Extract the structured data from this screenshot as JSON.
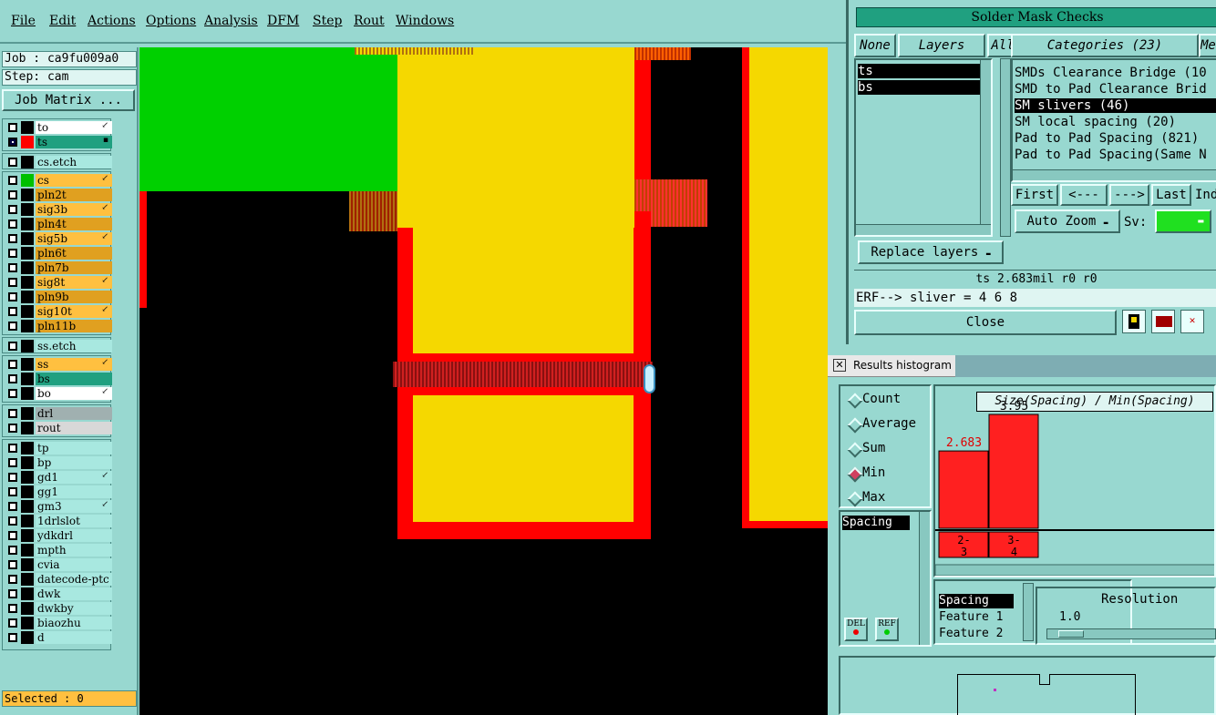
{
  "menu": {
    "items": [
      "File",
      "Edit",
      "Actions",
      "Options",
      "Analysis",
      "DFM",
      "Step",
      "Rout",
      "Windows"
    ]
  },
  "job": {
    "job_label": "Job : ca9fu009a0",
    "step_label": "Step: cam",
    "matrix_button": "Job Matrix ..."
  },
  "layers": {
    "group1": [
      {
        "name": "to",
        "color": "#000000",
        "bg": "#ffffff",
        "mark": "↙"
      },
      {
        "name": "ts",
        "color": "#ff0000",
        "bg": "#20a080",
        "mark": "▪",
        "selected": true
      }
    ],
    "group2": [
      {
        "name": "cs.etch",
        "color": "#000000",
        "bg": "#a8e8e0",
        "mark": ""
      }
    ],
    "group3": [
      {
        "name": "cs",
        "color": "#00c000",
        "bg": "#ffc040",
        "mark": "↙"
      },
      {
        "name": "pln2t",
        "color": "#000000",
        "bg": "#e0a020",
        "mark": ""
      },
      {
        "name": "sig3b",
        "color": "#000000",
        "bg": "#ffc040",
        "mark": "↙"
      },
      {
        "name": "pln4t",
        "color": "#000000",
        "bg": "#e0a020",
        "mark": ""
      },
      {
        "name": "sig5b",
        "color": "#000000",
        "bg": "#ffc040",
        "mark": "↙"
      },
      {
        "name": "pln6t",
        "color": "#000000",
        "bg": "#e0a020",
        "mark": ""
      },
      {
        "name": "pln7b",
        "color": "#000000",
        "bg": "#e0a020",
        "mark": ""
      },
      {
        "name": "sig8t",
        "color": "#000000",
        "bg": "#ffc040",
        "mark": "↙"
      },
      {
        "name": "pln9b",
        "color": "#000000",
        "bg": "#e0a020",
        "mark": ""
      },
      {
        "name": "sig10t",
        "color": "#000000",
        "bg": "#ffc040",
        "mark": "↙"
      },
      {
        "name": "pln11b",
        "color": "#000000",
        "bg": "#e0a020",
        "mark": ""
      }
    ],
    "group4": [
      {
        "name": "ss.etch",
        "color": "#000000",
        "bg": "#a8e8e0",
        "mark": ""
      }
    ],
    "group5": [
      {
        "name": "ss",
        "color": "#000000",
        "bg": "#ffc040",
        "mark": "↙"
      },
      {
        "name": "bs",
        "color": "#000000",
        "bg": "#20a080",
        "mark": ""
      },
      {
        "name": "bo",
        "color": "#000000",
        "bg": "#ffffff",
        "mark": "↙"
      }
    ],
    "group6": [
      {
        "name": "drl",
        "color": "#000000",
        "bg": "#a0b0b0",
        "mark": ""
      },
      {
        "name": "rout",
        "color": "#000000",
        "bg": "#d8d8d8",
        "mark": ""
      }
    ],
    "group7": [
      {
        "name": "tp",
        "color": "#000000",
        "bg": "#a8e8e0",
        "mark": ""
      },
      {
        "name": "bp",
        "color": "#000000",
        "bg": "#a8e8e0",
        "mark": ""
      },
      {
        "name": "gd1",
        "color": "#000000",
        "bg": "#a8e8e0",
        "mark": "↙"
      },
      {
        "name": "gg1",
        "color": "#000000",
        "bg": "#a8e8e0",
        "mark": ""
      },
      {
        "name": "gm3",
        "color": "#000000",
        "bg": "#a8e8e0",
        "mark": "↙"
      },
      {
        "name": "1drlslot",
        "color": "#000000",
        "bg": "#a8e8e0",
        "mark": ""
      },
      {
        "name": "ydkdrl",
        "color": "#000000",
        "bg": "#a8e8e0",
        "mark": ""
      },
      {
        "name": "mpth",
        "color": "#000000",
        "bg": "#a8e8e0",
        "mark": ""
      },
      {
        "name": "cvia",
        "color": "#000000",
        "bg": "#a8e8e0",
        "mark": ""
      },
      {
        "name": "datecode-ptc",
        "color": "#000000",
        "bg": "#a8e8e0",
        "mark": ""
      },
      {
        "name": "dwk",
        "color": "#000000",
        "bg": "#a8e8e0",
        "mark": ""
      },
      {
        "name": "dwkby",
        "color": "#000000",
        "bg": "#a8e8e0",
        "mark": ""
      },
      {
        "name": "biaozhu",
        "color": "#000000",
        "bg": "#a8e8e0",
        "mark": ""
      },
      {
        "name": "d",
        "color": "#000000",
        "bg": "#a8e8e0",
        "mark": ""
      }
    ],
    "selected_status": "Selected : 0"
  },
  "solder_mask": {
    "title": "Solder Mask Checks",
    "none_btn": "None",
    "layers_btn": "Layers",
    "all_btn": "All",
    "categories_btn": "Categories (23)",
    "meas_btn": "Me",
    "layer_items": [
      "ts",
      "bs"
    ],
    "categories": [
      "SMDs Clearance Bridge (10",
      "SMD to Pad Clearance Brid",
      "SM slivers (46)",
      "SM local spacing (20)",
      "Pad to Pad Spacing (821)",
      "Pad to Pad Spacing(Same N"
    ],
    "selected_category": 2,
    "nav": {
      "first": "First",
      "prev": "<---",
      "next": "--->",
      "last": "Last",
      "ind": "Ind"
    },
    "auto_zoom": "Auto Zoom",
    "sv_label": "Sv:",
    "replace_layers": "Replace layers",
    "status_line": "ts 2.683mil  r0  r0",
    "erf_line": "ERF--> sliver = 4 6 8",
    "close_btn": "Close"
  },
  "histogram": {
    "title": "Results histogram",
    "modes": [
      "Count",
      "Average",
      "Sum",
      "Min",
      "Max"
    ],
    "selected_mode": "Min",
    "list_item": "Spacing",
    "del_btn": "DEL",
    "ref_btn": "REF",
    "chart_title": "Size(Spacing) / Min(Spacing)",
    "attr_items": [
      "Spacing",
      "Feature 1",
      "Feature 2"
    ],
    "resolution_label": "Resolution",
    "resolution_value": "1.0",
    "accent": "#ff2020"
  },
  "chart_data": {
    "type": "bar",
    "title": "Size(Spacing) / Min(Spacing)",
    "categories": [
      "2-3",
      "3-4"
    ],
    "values": [
      2.683,
      3.95
    ],
    "value_labels": [
      "2.683",
      "3.95"
    ],
    "bar_labels": [
      "2-\n3",
      "3-\n4"
    ]
  }
}
